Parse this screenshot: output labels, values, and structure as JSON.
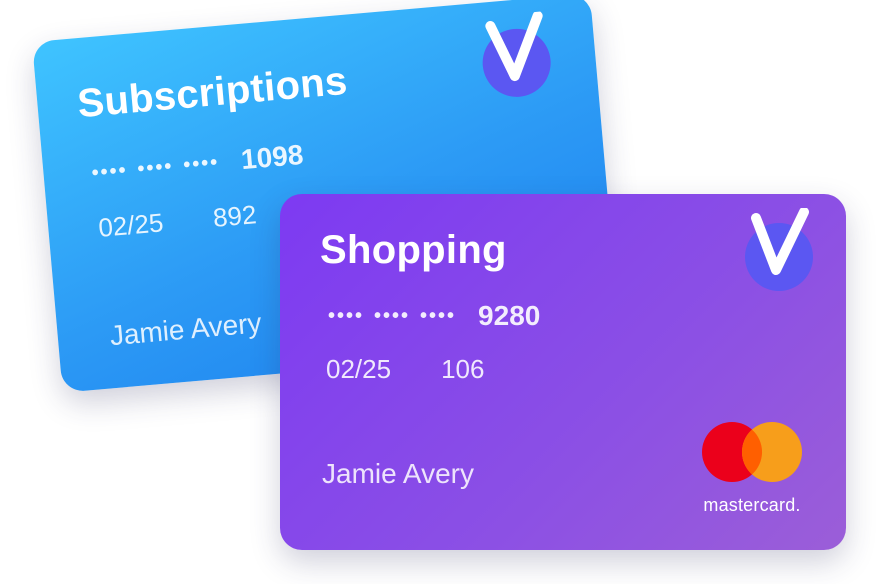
{
  "cards": [
    {
      "title": "Subscriptions",
      "masked_groups": [
        "••••",
        "••••",
        "••••"
      ],
      "last4": "1098",
      "expiry": "02/25",
      "cvv": "892",
      "holder": "Jamie Avery",
      "brand_icon": "v-logo-icon",
      "gradient": [
        "#3fc4ff",
        "#1c7fee"
      ]
    },
    {
      "title": "Shopping",
      "masked_groups": [
        "••••",
        "••••",
        "••••"
      ],
      "last4": "9280",
      "expiry": "02/25",
      "cvv": "106",
      "holder": "Jamie Avery",
      "brand_icon": "v-logo-icon",
      "network_logo": "mastercard-logo",
      "network_label": "mastercard.",
      "gradient": [
        "#7d3af2",
        "#9b5ed8"
      ]
    }
  ],
  "colors": {
    "v_logo_circle": "#5b57f2",
    "v_logo_glyph": "#ffffff",
    "mc_red": "#eb001b",
    "mc_orange": "#f79e1b",
    "mc_overlap": "#ff5f00"
  }
}
